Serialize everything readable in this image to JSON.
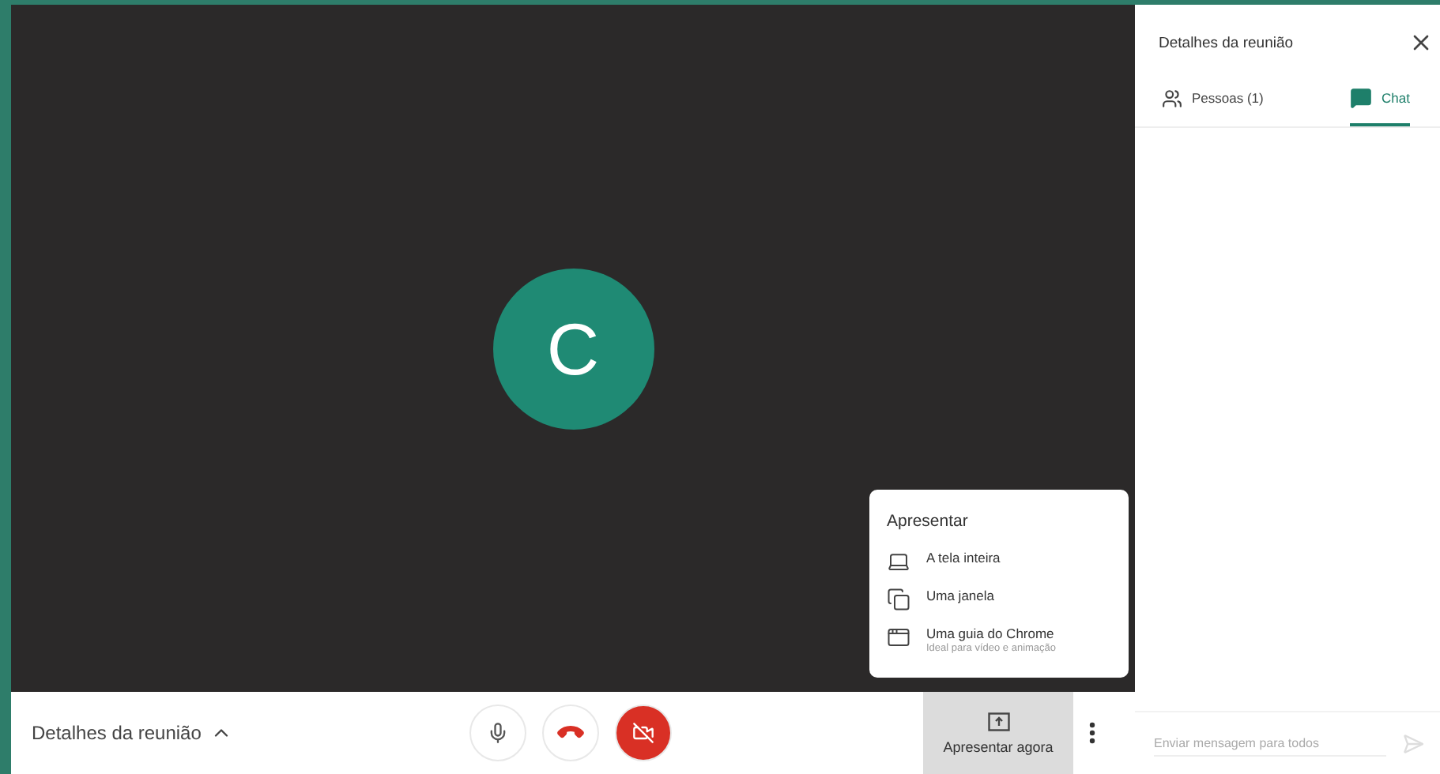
{
  "meeting": {
    "avatar_letter": "C"
  },
  "present_menu": {
    "title": "Apresentar",
    "options": [
      {
        "kind": "screen",
        "label": "A tela inteira"
      },
      {
        "kind": "window",
        "label": "Uma janela"
      },
      {
        "kind": "tab",
        "label": "Uma guia do Chrome",
        "hint": "Ideal para vídeo e animação"
      }
    ]
  },
  "bottom_bar": {
    "details_label": "Detalhes da reunião",
    "controls": [
      {
        "kind": "mic",
        "on": true
      },
      {
        "kind": "hangup"
      },
      {
        "kind": "camera",
        "on": false
      }
    ],
    "present_button": {
      "label": "Apresentar agora",
      "selected": true
    }
  },
  "side_panel": {
    "title": "Detalhes da reunião",
    "tabs": [
      {
        "kind": "people",
        "label": "Pessoas (1)",
        "selected": false
      },
      {
        "kind": "chat",
        "label": "Chat",
        "selected": true
      }
    ],
    "message_field": {
      "placeholder": "Enviar mensagem para todos"
    }
  }
}
